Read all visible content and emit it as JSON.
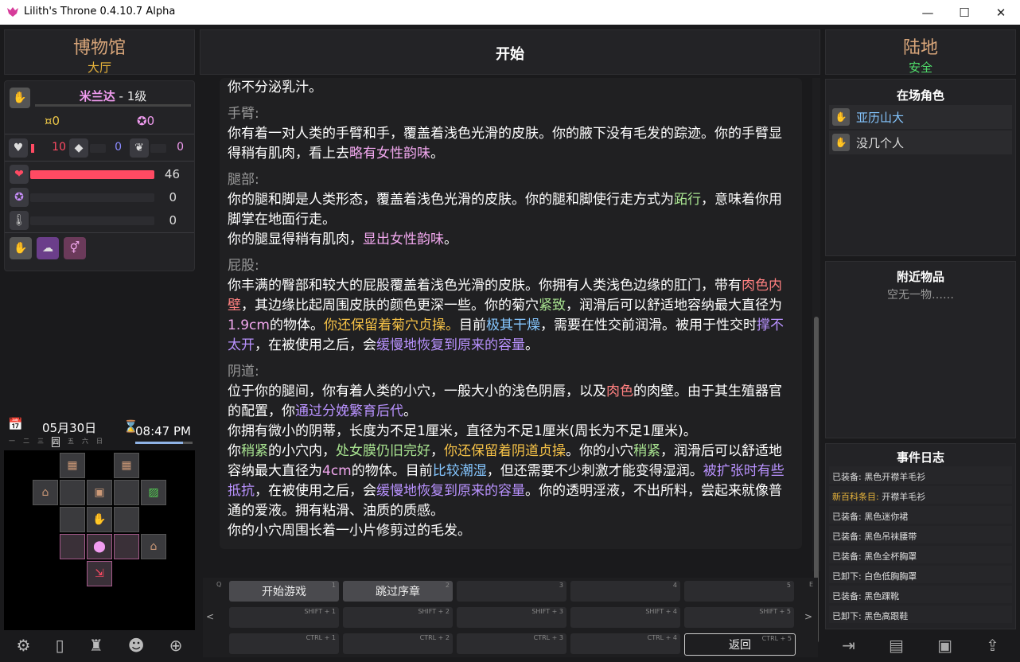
{
  "window": {
    "title": "Lilith's Throne 0.4.10.7 Alpha"
  },
  "location_left": {
    "name": "博物馆",
    "sub": "大厅"
  },
  "location_center": {
    "title": "开始"
  },
  "location_right": {
    "name": "陆地",
    "status": "安全"
  },
  "player": {
    "name": "米兰达",
    "level": " - 1级",
    "essence": "¤0",
    "arcane": "✪0",
    "res1": "10",
    "res2": "0",
    "res3": "0",
    "health": "46",
    "health_fraction": 1.0,
    "mana": "0",
    "lust": "0"
  },
  "datetime": {
    "date": "05月30日",
    "time": "08:47 PM",
    "weekdays": [
      "一",
      "二",
      "三",
      "四",
      "五",
      "六",
      "日"
    ],
    "current_weekday": 3
  },
  "body_text": [
    {
      "hd": "",
      "lines": [
        [
          [
            "p",
            "你不分泌乳汁。"
          ]
        ]
      ]
    },
    {
      "hd": "手臂:",
      "lines": [
        [
          [
            "p",
            "你有着一对人类的手臂和手，覆盖着浅色光滑的皮肤。你的腋下没有毛发的踪迹。你的手臂显得稍有肌肉，看上去"
          ],
          [
            "pk",
            "略有女性韵味"
          ],
          [
            "p",
            "。"
          ]
        ]
      ]
    },
    {
      "hd": "腿部:",
      "lines": [
        [
          [
            "p",
            "你的腿和脚是人类形态，覆盖着浅色光滑的皮肤。你的腿和脚使行走方式为"
          ],
          [
            "gr",
            "跖行"
          ],
          [
            "p",
            "，意味着你用脚掌在地面行走。"
          ]
        ],
        [
          [
            "p",
            "你的腿显得稍有肌肉，"
          ],
          [
            "pk",
            "显出女性韵味"
          ],
          [
            "p",
            "。"
          ]
        ]
      ]
    },
    {
      "hd": "屁股:",
      "lines": [
        [
          [
            "p",
            "你丰满的臀部和较大的屁股覆盖着浅色光滑的皮肤。你拥有人类浅色边缘的肛门，带有"
          ],
          [
            "rd",
            "肉色内壁"
          ],
          [
            "p",
            "，其边缘比起周围皮肤的颜色更深一些。你的菊穴"
          ],
          [
            "gr",
            "紧致"
          ],
          [
            "p",
            "，润滑后可以舒适地容纳最大直径为"
          ],
          [
            "pk",
            "1.9cm"
          ],
          [
            "p",
            "的物体。"
          ],
          [
            "or",
            "你还保留着菊穴贞操。"
          ],
          [
            "p",
            "目前"
          ],
          [
            "bl",
            "极其干燥"
          ],
          [
            "p",
            "，需要在性交前润滑。被用于性交时"
          ],
          [
            "pu",
            "撑不太开"
          ],
          [
            "p",
            "，在被使用之后，会"
          ],
          [
            "pu",
            "缓慢地恢复到原来的容量"
          ],
          [
            "p",
            "。"
          ]
        ]
      ]
    },
    {
      "hd": "阴道:",
      "lines": [
        [
          [
            "p",
            "位于你的腿间，你有着人类的小穴，一般大小的浅色阴唇，以及"
          ],
          [
            "rd",
            "肉色"
          ],
          [
            "p",
            "的肉壁。由于其生殖器官的配置，你"
          ],
          [
            "pu",
            "通过分娩繁育后代"
          ],
          [
            "p",
            "。"
          ]
        ],
        [
          [
            "p",
            "你拥有微小的阴蒂，长度为不足1厘米，直径为不足1厘米(周长为不足1厘米)。"
          ]
        ],
        [
          [
            "p",
            "你"
          ],
          [
            "gr",
            "稍紧"
          ],
          [
            "p",
            "的小穴内，"
          ],
          [
            "gr",
            "处女膜仍旧完好"
          ],
          [
            "p",
            "，"
          ],
          [
            "or",
            "你还保留着阴道贞操"
          ],
          [
            "p",
            "。你的小穴"
          ],
          [
            "gr",
            "稍紧"
          ],
          [
            "p",
            "，润滑后可以舒适地容纳最大直径为"
          ],
          [
            "pk",
            "4cm"
          ],
          [
            "p",
            "的物体。目前"
          ],
          [
            "bl",
            "比较潮湿"
          ],
          [
            "p",
            "，但还需要不少刺激才能变得湿润。"
          ],
          [
            "pu",
            "被扩张时有些抵抗"
          ],
          [
            "p",
            "，在被使用之后，会"
          ],
          [
            "pu",
            "缓慢地恢复到原来的容量"
          ],
          [
            "p",
            "。你的透明淫液，不出所料，尝起来就像普通的爱液。拥有粘滑、油质的质感。"
          ]
        ],
        [
          [
            "p",
            "你的小穴周围长着一小片修剪过的毛发。"
          ]
        ]
      ]
    }
  ],
  "actions": {
    "page_prev_key": "Q",
    "page_next_key": "E",
    "row1": [
      {
        "label": "开始游戏",
        "key": "1"
      },
      {
        "label": "跳过序章",
        "key": "2"
      },
      {
        "label": "",
        "key": "3"
      },
      {
        "label": "",
        "key": "4"
      },
      {
        "label": "",
        "key": "5"
      }
    ],
    "row2": [
      {
        "label": "",
        "key": "SHIFT + 1"
      },
      {
        "label": "",
        "key": "SHIFT + 2"
      },
      {
        "label": "",
        "key": "SHIFT + 3"
      },
      {
        "label": "",
        "key": "SHIFT + 4"
      },
      {
        "label": "",
        "key": "SHIFT + 5"
      }
    ],
    "row3": [
      {
        "label": "",
        "key": "CTRL + 1"
      },
      {
        "label": "",
        "key": "CTRL + 2"
      },
      {
        "label": "",
        "key": "CTRL + 3"
      },
      {
        "label": "",
        "key": "CTRL + 4"
      },
      {
        "label": "返回",
        "key": "CTRL + 5"
      }
    ]
  },
  "present": {
    "title": "在场角色",
    "chars": [
      "亚历山大",
      "没几个人"
    ]
  },
  "items": {
    "title": "附近物品",
    "empty": "空无一物……"
  },
  "events": {
    "title": "事件日志",
    "entries": [
      {
        "prefix": "已装备: ",
        "text": "黑色开襟羊毛衫",
        "highlight": false
      },
      {
        "prefix": "新百科条目: ",
        "text": "开襟羊毛衫",
        "highlight": true
      },
      {
        "prefix": "已装备: ",
        "text": "黑色迷你裙",
        "highlight": false
      },
      {
        "prefix": "已装备: ",
        "text": "黑色吊袜腰带",
        "highlight": false
      },
      {
        "prefix": "已装备: ",
        "text": "黑色全杯胸罩",
        "highlight": false
      },
      {
        "prefix": "已卸下: ",
        "text": "白色低胸胸罩",
        "highlight": false
      },
      {
        "prefix": "已装备: ",
        "text": "黑色踝靴",
        "highlight": false
      },
      {
        "prefix": "已卸下: ",
        "text": "黑色高跟鞋",
        "highlight": false
      }
    ]
  },
  "colors": {
    "accent_pink": "#ff4a63",
    "title_tan": "#d9a67a",
    "safe_green": "#4fdc6a",
    "name_pink": "#f19cf0",
    "highlight_gold": "#e8b43b"
  }
}
